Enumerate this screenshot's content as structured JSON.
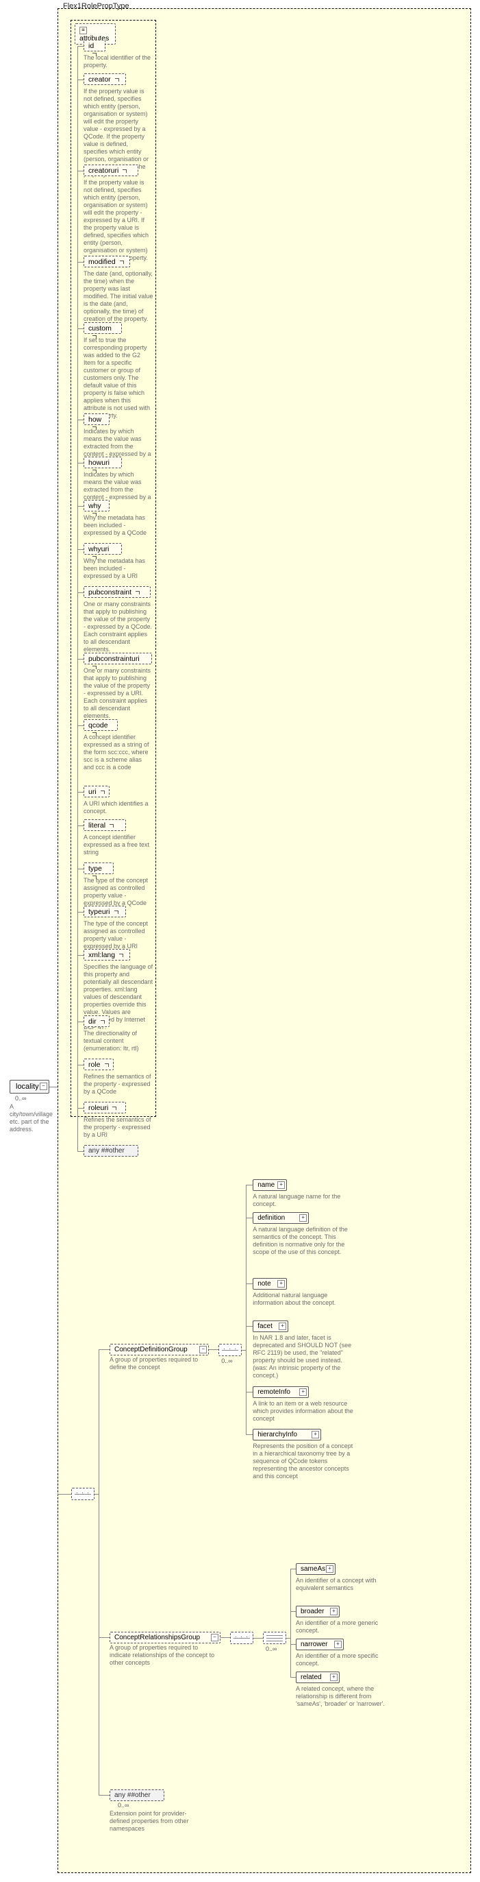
{
  "type_name": "Flex1RolePropType",
  "attributes_header": "attributes",
  "root": {
    "name": "locality",
    "occ": "0..∞",
    "desc": "A city/town/village etc. part of the address."
  },
  "any_other": "any ##other",
  "attrs": [
    {
      "name": "id",
      "desc": "The local identifier of the property."
    },
    {
      "name": "creator",
      "desc": "If the property value is not defined, specifies which entity (person, organisation or system) will edit the property value - expressed by a QCode. If the property value is defined, specifies which entity (person, organisation or system) has edited the property value."
    },
    {
      "name": "creatoruri",
      "desc": "If the property value is not defined, specifies which entity (person, organisation or system) will edit the property - expressed by a URI. If the property value is defined, specifies which entity (person, organisation or system) has edited the property."
    },
    {
      "name": "modified",
      "desc": "The date (and, optionally, the time) when the property was last modified. The initial value is the date (and, optionally, the time) of creation of the property."
    },
    {
      "name": "custom",
      "desc": "If set to true the corresponding property was added to the G2 Item for a specific customer or group of customers only. The default value of this property is false which applies when this attribute is not used with the property."
    },
    {
      "name": "how",
      "desc": "Indicates by which means the value was extracted from the content - expressed by a QCode"
    },
    {
      "name": "howuri",
      "desc": "Indicates by which means the value was extracted from the content - expressed by a URI"
    },
    {
      "name": "why",
      "desc": "Why the metadata has been included - expressed by a QCode"
    },
    {
      "name": "whyuri",
      "desc": "Why the metadata has been included - expressed by a URI"
    },
    {
      "name": "pubconstraint",
      "desc": "One or many constraints that apply to publishing the value of the property - expressed by a QCode. Each constraint applies to all descendant elements."
    },
    {
      "name": "pubconstrainturi",
      "desc": "One or many constraints that apply to publishing the value of the property - expressed by a URI. Each constraint applies to all descendant elements."
    },
    {
      "name": "qcode",
      "desc": "A concept identifier expressed as a string of the form scc:ccc, where scc is a scheme alias and ccc is a code"
    },
    {
      "name": "uri",
      "desc": "A URI which identifies a concept."
    },
    {
      "name": "literal",
      "desc": "A concept identifier expressed as a free text string"
    },
    {
      "name": "type",
      "desc": "The type of the concept assigned as controlled property value - expressed by a QCode"
    },
    {
      "name": "typeuri",
      "desc": "The type of the concept assigned as controlled property value - expressed by a URI"
    },
    {
      "name": "xml:lang",
      "desc": "Specifies the language of this property and potentially all descendant properties. xml:lang values of descendant properties override this value. Values are determined by Internet BCP 47."
    },
    {
      "name": "dir",
      "desc": "The directionality of textual content (enumeration: ltr, rtl)"
    },
    {
      "name": "role",
      "desc": "Refines the semantics of the property - expressed by a QCode"
    },
    {
      "name": "roleuri",
      "desc": "Refines the semantics of the property - expressed by a URI"
    }
  ],
  "groups": {
    "cdef": {
      "name": "ConceptDefinitionGroup",
      "desc": "A group of properties required to define the concept",
      "occ": "0..∞",
      "items": [
        {
          "name": "name",
          "desc": "A natural language name for the concept."
        },
        {
          "name": "definition",
          "desc": "A natural language definition of the semantics of the concept. This definition is normative only for the scope of the use of this concept."
        },
        {
          "name": "note",
          "desc": "Additional natural language information about the concept."
        },
        {
          "name": "facet",
          "desc": "In NAR 1.8 and later, facet is deprecated and SHOULD NOT (see RFC 2119) be used, the \"related\" property should be used instead. (was: An intrinsic property of the concept.)"
        },
        {
          "name": "remoteInfo",
          "desc": "A link to an item or a web resource which provides information about the concept"
        },
        {
          "name": "hierarchyInfo",
          "desc": "Represents the position of a concept in a hierarchical taxonomy tree by a sequence of QCode tokens representing the ancestor concepts and this concept"
        }
      ]
    },
    "crel": {
      "name": "ConceptRelationshipsGroup",
      "desc": "A group of properties required to indicate relationships of the concept to other concepts",
      "occ": "0..∞",
      "items": [
        {
          "name": "sameAs",
          "desc": "An identifier of a concept with equivalent semantics"
        },
        {
          "name": "broader",
          "desc": "An identifier of a more generic concept."
        },
        {
          "name": "narrower",
          "desc": "An identifier of a more specific concept."
        },
        {
          "name": "related",
          "desc": "A related concept, where the relationship is different from 'sameAs', 'broader' or 'narrower'."
        }
      ]
    },
    "ext": {
      "name": "any ##other",
      "desc": "Extension point for provider-defined properties from other namespaces",
      "occ": "0..∞"
    }
  }
}
